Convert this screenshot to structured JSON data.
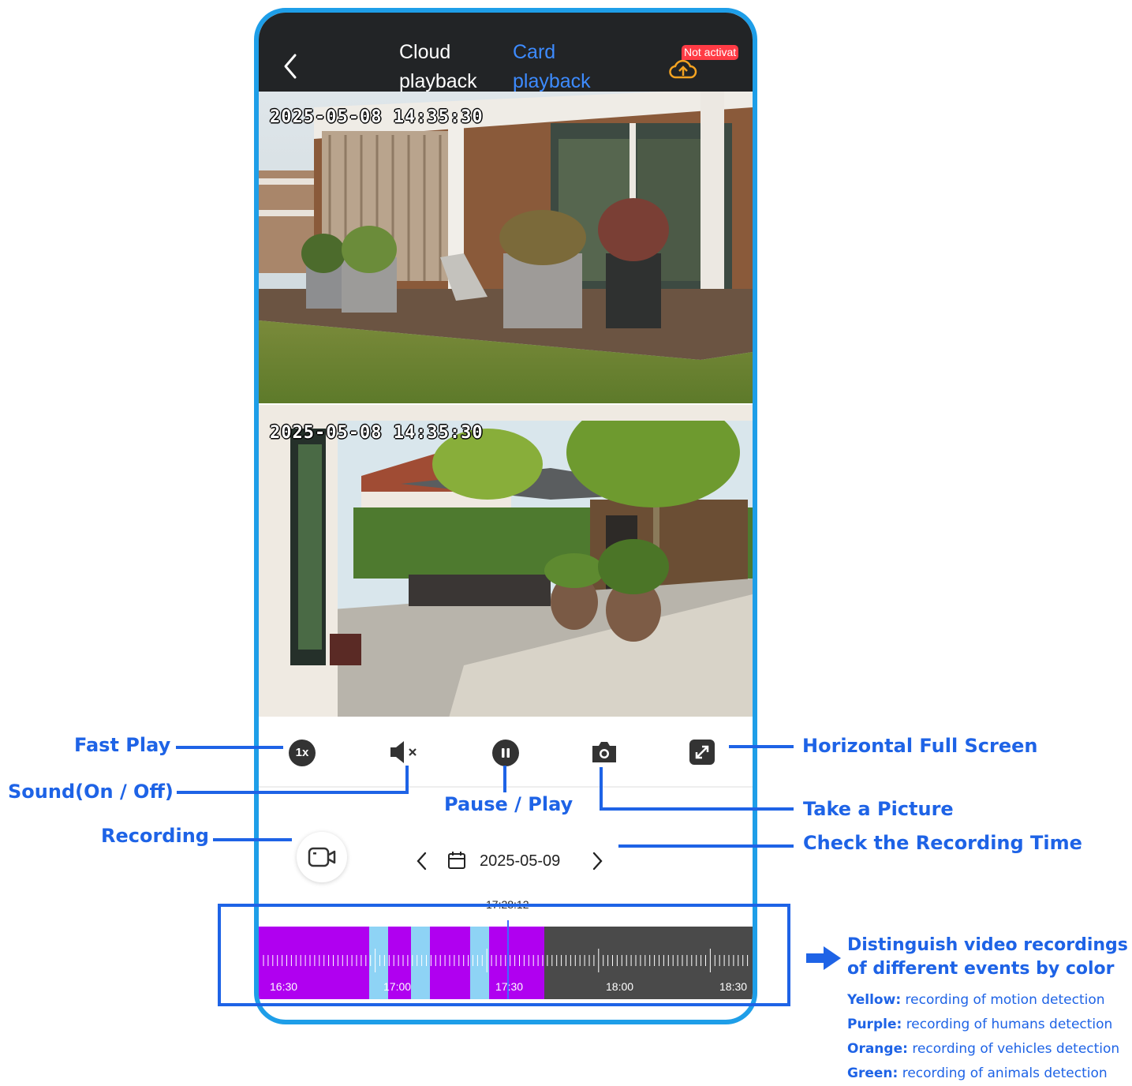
{
  "header": {
    "back_icon": "chevron-left-icon",
    "tab_cloud": "Cloud playback",
    "tab_cloud_line1": "Cloud",
    "tab_cloud_line2": "playback",
    "tab_card_line1": "Card",
    "tab_card_line2": "playback",
    "cloud_icon": "cloud-upload-icon",
    "badge": "Not activat"
  },
  "videos": [
    {
      "timestamp": "2025-05-08 14:35:30"
    },
    {
      "timestamp": "2025-05-08 14:35:30"
    }
  ],
  "controls": {
    "speed": "1x",
    "sound_icon": "speaker-mute-icon",
    "pause_icon": "pause-icon",
    "camera_icon": "camera-icon",
    "fullscreen_icon": "expand-icon"
  },
  "date_nav": {
    "record_icon": "video-camera-icon",
    "prev_icon": "chevron-left-icon",
    "calendar_icon": "calendar-icon",
    "date": "2025-05-09",
    "next_icon": "chevron-right-icon"
  },
  "timeline": {
    "current_time": "17:28:12",
    "labels": [
      "16:30",
      "17:00",
      "17:30",
      "18:00",
      "18:30"
    ],
    "colors": {
      "purple": "#b000f0",
      "light_blue": "#8ed3f5",
      "dark": "#4a4a4a"
    }
  },
  "annotations": {
    "fast_play": "Fast Play",
    "sound": "Sound(On / Off)",
    "recording": "Recording",
    "pause_play": "Pause / Play",
    "horizontal_full_screen": "Horizontal Full Screen",
    "take_picture": "Take a Picture",
    "check_recording_time": "Check the Recording Time",
    "distinguish_line1": "Distinguish video recordings",
    "distinguish_line2": "of different events by color"
  },
  "legend": [
    {
      "label": "Yellow:",
      "text": "recording of motion detection"
    },
    {
      "label": "Purple:",
      "text": "recording of humans detection"
    },
    {
      "label": "Orange:",
      "text": "recording of vehicles detection"
    },
    {
      "label": "Green:",
      "text": "recording of animals detection"
    }
  ],
  "accent_color": "#1e63e6",
  "frame_color": "#1e9ee8"
}
